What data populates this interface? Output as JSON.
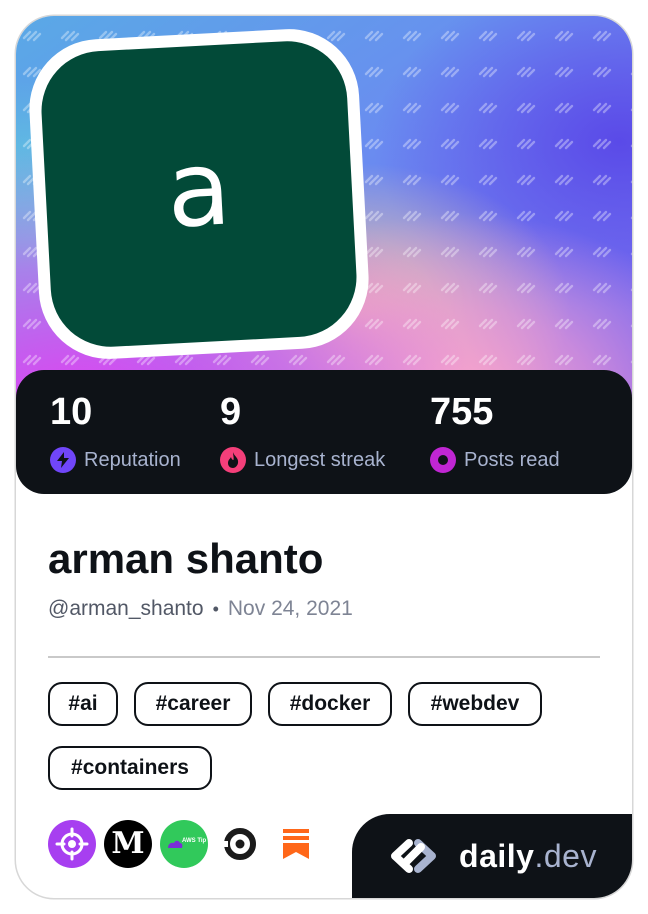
{
  "profile": {
    "avatar_letter": "a",
    "name": "arman shanto",
    "handle": "@arman_shanto",
    "separator": "•",
    "joined": "Nov 24, 2021"
  },
  "stats": [
    {
      "value": "10",
      "label": "Reputation",
      "icon": "lightning-icon",
      "color": "#7046f9"
    },
    {
      "value": "9",
      "label": "Longest streak",
      "icon": "flame-icon",
      "color": "#f43f7a"
    },
    {
      "value": "755",
      "label": "Posts read",
      "icon": "eye-icon",
      "color": "#c026d3"
    }
  ],
  "tags": [
    "#ai",
    "#career",
    "#docker",
    "#webdev",
    "#containers"
  ],
  "sources": [
    {
      "name": "crosshair-source-icon",
      "color": "#a73ff0"
    },
    {
      "name": "medium-source-icon",
      "glyph": "M",
      "color": "#000000"
    },
    {
      "name": "aws-tip-source-icon",
      "text": "AWS Tip",
      "color": "#31c95b"
    },
    {
      "name": "circle-o-source-icon",
      "color": "#1b1b1b"
    },
    {
      "name": "substack-source-icon",
      "color": "#ff6719"
    }
  ],
  "brand": {
    "main": "daily",
    "sub": ".dev"
  }
}
